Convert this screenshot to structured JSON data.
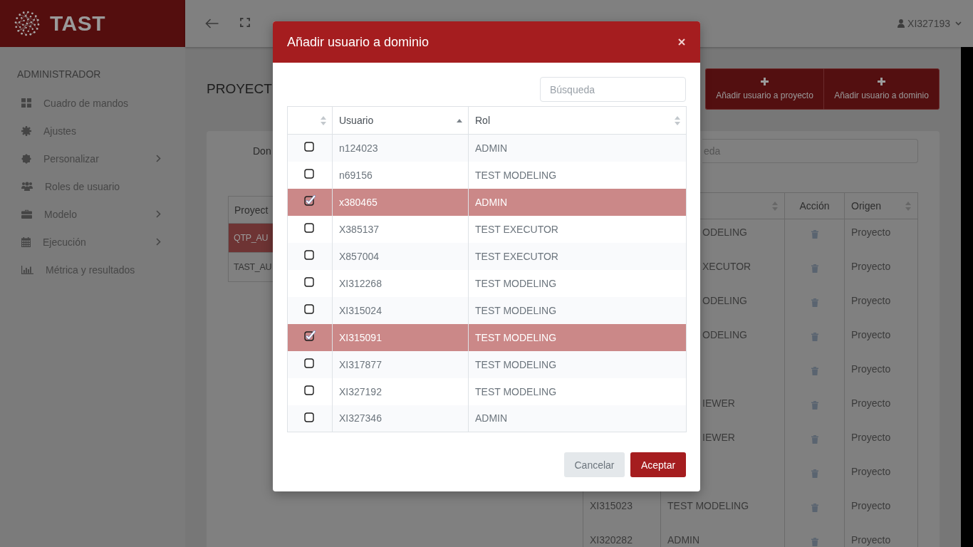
{
  "sidebar": {
    "logo": "TAST",
    "section": "ADMINISTRADOR",
    "items": [
      {
        "label": "Cuadro de mandos",
        "has_submenu": false
      },
      {
        "label": "Ajustes",
        "has_submenu": false
      },
      {
        "label": "Personalizar",
        "has_submenu": true
      },
      {
        "label": "Roles de usuario",
        "has_submenu": false
      },
      {
        "label": "Modelo",
        "has_submenu": true
      },
      {
        "label": "Ejecución",
        "has_submenu": true
      },
      {
        "label": "Métrica y resultados",
        "has_submenu": false
      }
    ]
  },
  "top_bar": {
    "user": "XI327193"
  },
  "page": {
    "title": "PROYECT",
    "actions": [
      {
        "label": "Añadir usuario a proyecto"
      },
      {
        "label": "Añadir usuario a dominio"
      }
    ],
    "filter": {
      "label": "Don",
      "placeholder": "eda"
    },
    "projects_table": {
      "column": "Proyect",
      "rows": [
        {
          "name": "QTP_AU",
          "selected": true
        },
        {
          "name": "TAST_AU",
          "selected": false
        }
      ]
    },
    "members_table": {
      "columns": [
        {
          "sortable": true
        },
        {
          "label": "Acción",
          "sortable": false
        },
        {
          "label": "Origen",
          "sortable": true
        }
      ],
      "rows": [
        {
          "rol": "ODELING",
          "origen": "Proyecto"
        },
        {
          "rol": "XECUTOR",
          "origen": "Proyecto"
        },
        {
          "rol": "ODELING",
          "origen": "Proyecto"
        },
        {
          "rol": "ODELING",
          "origen": "Proyecto"
        },
        {
          "origen": "Proyecto"
        },
        {
          "rol": "IEWER",
          "origen": "Proyecto"
        },
        {
          "rol": "IEWER",
          "origen": "Proyecto"
        },
        {
          "origen": "Proyecto"
        },
        {
          "usuario": "XI315023",
          "rol": "TEST MODELING",
          "origen": "Proyecto"
        },
        {
          "usuario": "XI320282",
          "rol": "ADMIN",
          "origen": "Proyecto"
        }
      ]
    }
  },
  "modal": {
    "title": "Añadir usuario a dominio",
    "search": {
      "placeholder": "Búsqueda"
    },
    "columns": [
      {
        "sortable": true,
        "sorted_ascending": false
      },
      {
        "label": "Usuario",
        "sortable": true,
        "sorted_ascending": true
      },
      {
        "label": "Rol",
        "sortable": true,
        "sorted_ascending": false
      }
    ],
    "rows": [
      {
        "usuario": "n124023",
        "rol": "ADMIN",
        "checked": false,
        "selected": false
      },
      {
        "usuario": "n69156",
        "rol": "TEST MODELING",
        "checked": false,
        "selected": false
      },
      {
        "usuario": "x380465",
        "rol": "ADMIN",
        "checked": true,
        "selected": true
      },
      {
        "usuario": "X385137",
        "rol": "TEST EXECUTOR",
        "checked": false,
        "selected": false
      },
      {
        "usuario": "X857004",
        "rol": "TEST EXECUTOR",
        "checked": false,
        "selected": false
      },
      {
        "usuario": "XI312268",
        "rol": "TEST MODELING",
        "checked": false,
        "selected": false
      },
      {
        "usuario": "XI315024",
        "rol": "TEST MODELING",
        "checked": false,
        "selected": false
      },
      {
        "usuario": "XI315091",
        "rol": "TEST MODELING",
        "checked": true,
        "selected": true
      },
      {
        "usuario": "XI317877",
        "rol": "TEST MODELING",
        "checked": false,
        "selected": false
      },
      {
        "usuario": "XI327192",
        "rol": "TEST MODELING",
        "checked": false,
        "selected": false
      },
      {
        "usuario": "XI327346",
        "rol": "ADMIN",
        "checked": false,
        "selected": false
      }
    ],
    "buttons": [
      {
        "label": "Cancelar",
        "kind": "secondary"
      },
      {
        "label": "Aceptar",
        "kind": "primary"
      }
    ]
  }
}
